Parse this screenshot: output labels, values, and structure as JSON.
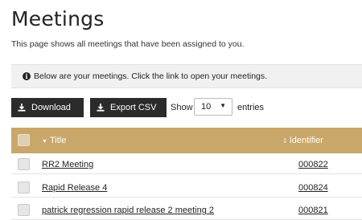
{
  "page": {
    "title": "Meetings",
    "subtitle": "This page shows all meetings that have been assigned to you."
  },
  "info_banner": {
    "icon": "info-circle-icon",
    "icon_glyph": "i",
    "text": "Below are your meetings. Click the link to open your meetings."
  },
  "toolbar": {
    "download_label": "Download",
    "export_label": "Export CSV",
    "show_label": "Show",
    "entries_value": "10",
    "entries_label": "entries"
  },
  "table": {
    "header_color": "#c9a76a",
    "columns": [
      {
        "label": "Title",
        "sort": "descending"
      },
      {
        "label": "Identifier",
        "sort": "sortable"
      }
    ],
    "rows": [
      {
        "title": "RR2 Meeting",
        "identifier": "000822"
      },
      {
        "title": "Rapid Release 4",
        "identifier": "000824"
      },
      {
        "title": "patrick regression rapid release 2 meeting 2",
        "identifier": "000821"
      }
    ]
  }
}
